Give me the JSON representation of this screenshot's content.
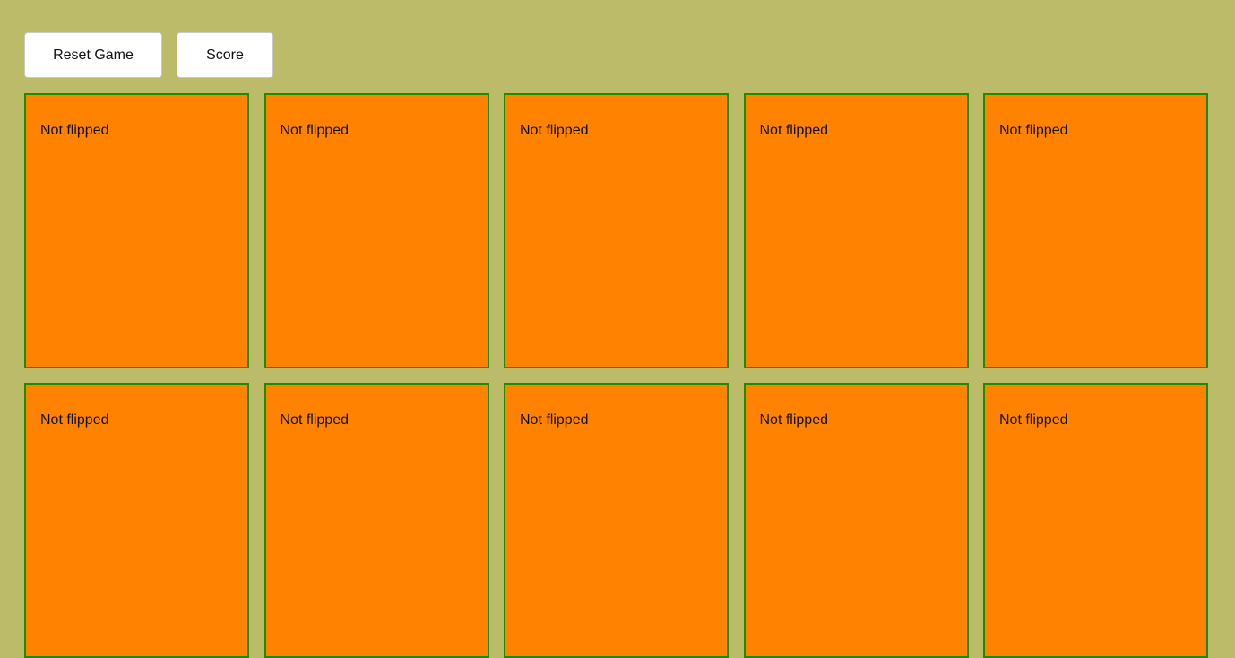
{
  "toolbar": {
    "reset_label": "Reset Game",
    "score_label": "Score"
  },
  "cards": [
    {
      "label": "Not flipped"
    },
    {
      "label": "Not flipped"
    },
    {
      "label": "Not flipped"
    },
    {
      "label": "Not flipped"
    },
    {
      "label": "Not flipped"
    },
    {
      "label": "Not flipped"
    },
    {
      "label": "Not flipped"
    },
    {
      "label": "Not flipped"
    },
    {
      "label": "Not flipped"
    },
    {
      "label": "Not flipped"
    }
  ],
  "colors": {
    "background": "#bbbb69",
    "card_back": "#ff8200",
    "card_border": "#1a8f00",
    "button_bg": "#ffffff"
  }
}
